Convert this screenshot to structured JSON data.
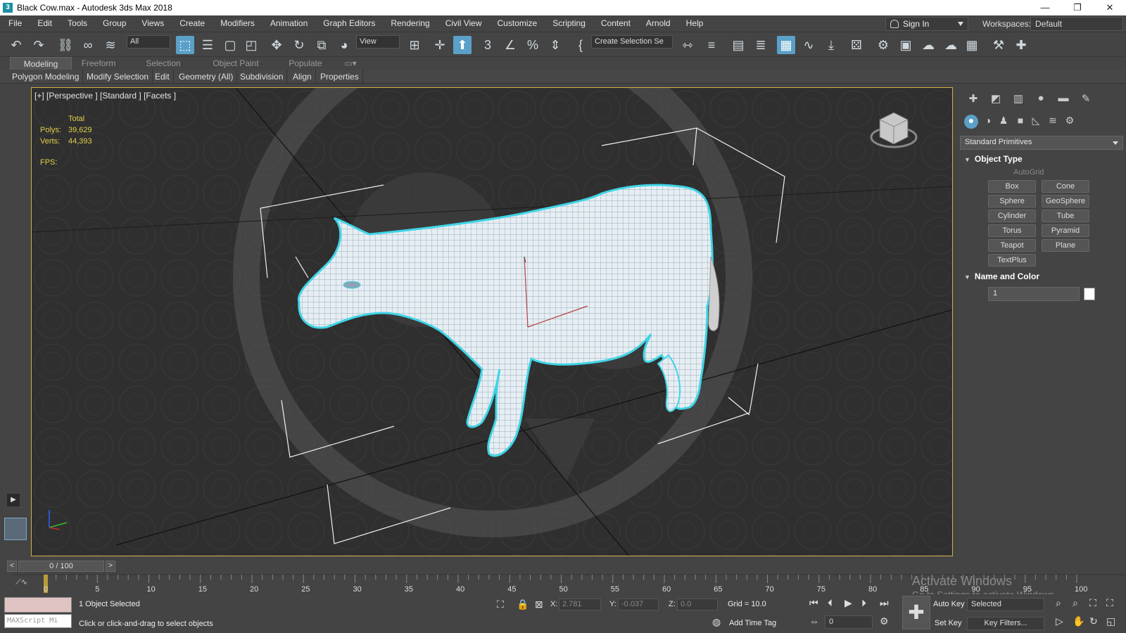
{
  "window": {
    "title": "Black Cow.max - Autodesk 3ds Max 2018",
    "app_icon": "3",
    "minimize": "—",
    "maximize": "❐",
    "close": "✕"
  },
  "menu": {
    "items": [
      "File",
      "Edit",
      "Tools",
      "Group",
      "Views",
      "Create",
      "Modifiers",
      "Animation",
      "Graph Editors",
      "Rendering",
      "Civil View",
      "Customize",
      "Scripting",
      "Content",
      "Arnold",
      "Help"
    ],
    "sign_in": "Sign In",
    "workspaces_label": "Workspaces:",
    "workspace_value": "Default"
  },
  "toolbar": {
    "selection_filter": "All",
    "ref_coord": "View",
    "named_selection": "Create Selection Se"
  },
  "ribbon": {
    "tabs": [
      "Modeling",
      "Freeform",
      "Selection",
      "Object Paint",
      "Populate"
    ],
    "panels": [
      "Polygon Modeling",
      "Modify Selection",
      "Edit",
      "Geometry (All)",
      "Subdivision",
      "Align",
      "Properties"
    ]
  },
  "viewport": {
    "label": "[+] [Perspective ] [Standard ] [Facets ]",
    "stats_header": "Total",
    "polys_label": "Polys:",
    "polys_value": "39,629",
    "verts_label": "Verts:",
    "verts_value": "44,393",
    "fps_label": "FPS:"
  },
  "command_panel": {
    "category": "Standard Primitives",
    "object_type_title": "Object Type",
    "autogrid": "AutoGrid",
    "buttons": [
      "Box",
      "Cone",
      "Sphere",
      "GeoSphere",
      "Cylinder",
      "Tube",
      "Torus",
      "Pyramid",
      "Teapot",
      "Plane",
      "TextPlus"
    ],
    "name_color_title": "Name and Color",
    "name_value": "1"
  },
  "timeline": {
    "slider": "0 / 100",
    "ticks": [
      "0",
      "5",
      "10",
      "15",
      "20",
      "25",
      "30",
      "35",
      "40",
      "45",
      "50",
      "55",
      "60",
      "65",
      "70",
      "75",
      "80",
      "85",
      "90",
      "95",
      "100"
    ]
  },
  "watermark": {
    "line1": "Activate Windows",
    "line2": "Go to Settings to activate Windows."
  },
  "status": {
    "maxscript": "MAXScript Mi",
    "selected": "1 Object Selected",
    "prompt": "Click or click-and-drag to select objects",
    "x_label": "X:",
    "x_value": "2.781",
    "y_label": "Y:",
    "y_value": "-0.037",
    "z_label": "Z:",
    "z_value": "0.0",
    "grid": "Grid = 10.0",
    "add_time_tag": "Add Time Tag",
    "auto_key": "Auto Key",
    "set_key": "Set Key",
    "selected_dd": "Selected",
    "frame_value": "0",
    "key_filters": "Key Filters..."
  },
  "colors": {
    "accent": "#5aa0c8",
    "viewport_border": "#d4b04a",
    "stats_text": "#e2d04a",
    "mesh": "#dce9f0",
    "mesh_outline": "#3fd4e6"
  }
}
